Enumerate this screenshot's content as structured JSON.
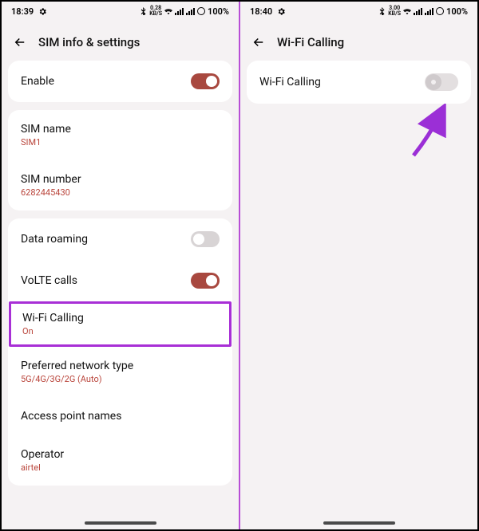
{
  "left": {
    "status": {
      "time": "18:39",
      "speed_top": "0.28",
      "speed_bot": "KB/S",
      "battery": "100%"
    },
    "header": {
      "title": "SIM info & settings"
    },
    "enable": {
      "label": "Enable"
    },
    "sim": {
      "name_label": "SIM name",
      "name_value": "SIM1",
      "number_label": "SIM number",
      "number_value": "6282445430"
    },
    "network": {
      "roaming_label": "Data roaming",
      "volte_label": "VoLTE calls",
      "wifi_calling_label": "Wi-Fi Calling",
      "wifi_calling_value": "On",
      "preferred_label": "Preferred network type",
      "preferred_value": "5G/4G/3G/2G (Auto)",
      "apn_label": "Access point names",
      "operator_label": "Operator",
      "operator_value": "airtel"
    }
  },
  "right": {
    "status": {
      "time": "18:40",
      "speed_top": "3.00",
      "speed_bot": "KB/S",
      "battery": "100%"
    },
    "header": {
      "title": "Wi-Fi Calling"
    },
    "wifi_calling": {
      "label": "Wi-Fi Calling"
    }
  }
}
